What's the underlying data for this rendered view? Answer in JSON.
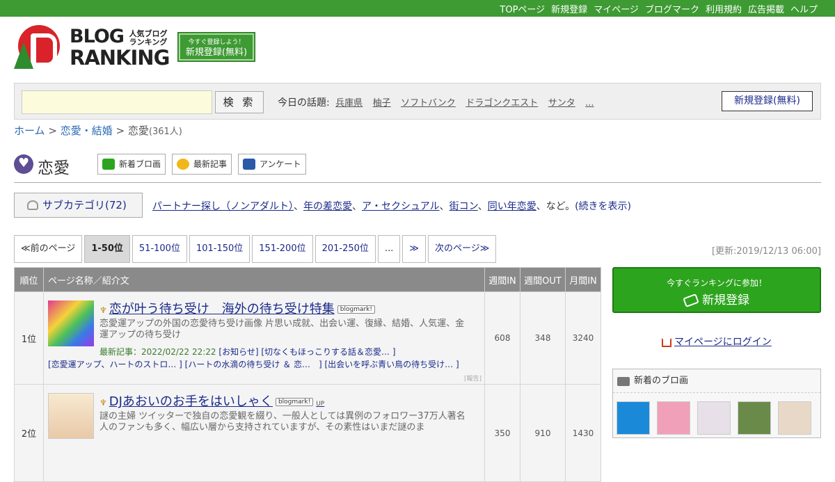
{
  "topnav": [
    "TOPページ",
    "新規登録",
    "マイページ",
    "ブログマーク",
    "利用規約",
    "広告掲載",
    "ヘルプ"
  ],
  "logo": {
    "line1": "BLOG",
    "line2": "RANKING",
    "sub": "人気ブログランキング"
  },
  "register_button": {
    "small": "今すぐ登録しよう！",
    "label": "新規登録(無料)"
  },
  "search": {
    "button": "検 索",
    "placeholder": ""
  },
  "topics": {
    "label": "今日の話題:",
    "items": [
      "兵庫県",
      "柚子",
      "ソフトバンク",
      "ドラゴンクエスト",
      "サンタ",
      "..."
    ]
  },
  "register_button2": "新規登録(無料)",
  "breadcrumb": {
    "home": "ホーム",
    "sep": ">",
    "parent": "恋愛・結婚",
    "current": "恋愛",
    "count": "(361人)"
  },
  "category": {
    "title": "恋愛",
    "buttons": [
      "新着ブロ画",
      "最新記事",
      "アンケート"
    ]
  },
  "subcategory": {
    "label": "サブカテゴリ(72)",
    "links": [
      "パートナー探し（ノンアダルト）",
      "年の差恋愛",
      "ア・セクシュアル",
      "街コン",
      "同い年恋愛"
    ],
    "suffix": "、など。",
    "more": "(続きを表示)"
  },
  "pager": [
    "≪前のページ",
    "1-50位",
    "51-100位",
    "101-150位",
    "151-200位",
    "201-250位",
    "...",
    "≫",
    "次のページ≫"
  ],
  "updated": "[更新:2019/12/13 06:00]",
  "table": {
    "headers": [
      "順位",
      "ページ名称／紹介文",
      "週間IN",
      "週間OUT",
      "月間IN"
    ],
    "rows": [
      {
        "rank": "1位",
        "title": "恋が叶う待ち受け　海外の待ち受け特集",
        "badge": "blogmark!",
        "desc": "恋愛運アップの外国の恋愛待ち受け画像 片思い成就、出会い運、復縁、結婚、人気運、金運アップの待ち受け",
        "latest_label": "最新記事：2022/02/22 22:22",
        "latest_links": "[お知らせ] [切なくもほっこりする話＆恋愛… ]",
        "related": "[恋愛運アップ、ハートのストロ… ] [ハートの水滴の待ち受け ＆ 恋…　] [出会いを呼ぶ青い鳥の待ち受け… ]",
        "report": "[報告]",
        "week_in": "608",
        "week_out": "348",
        "month_in": "3240"
      },
      {
        "rank": "2位",
        "title": "DJあおいのお手をはいしゃく",
        "badge": "blogmark!",
        "up": "UP",
        "desc": "謎の主婦 ツイッターで独自の恋愛観を綴り、一般人としては異例のフォロワー37万人著名人のファンも多く、幅広い層から支持されていますが、その素性はいまだ謎のま",
        "week_in": "350",
        "week_out": "910",
        "month_in": "1430"
      }
    ]
  },
  "side": {
    "reg_small": "今すぐランキングに参加！",
    "reg_label": "新規登録",
    "mypage": "マイページにログイン",
    "new_title": "新着のブロ画"
  },
  "colors": {
    "green": "#3e9a33",
    "link": "#1a2a8a"
  }
}
